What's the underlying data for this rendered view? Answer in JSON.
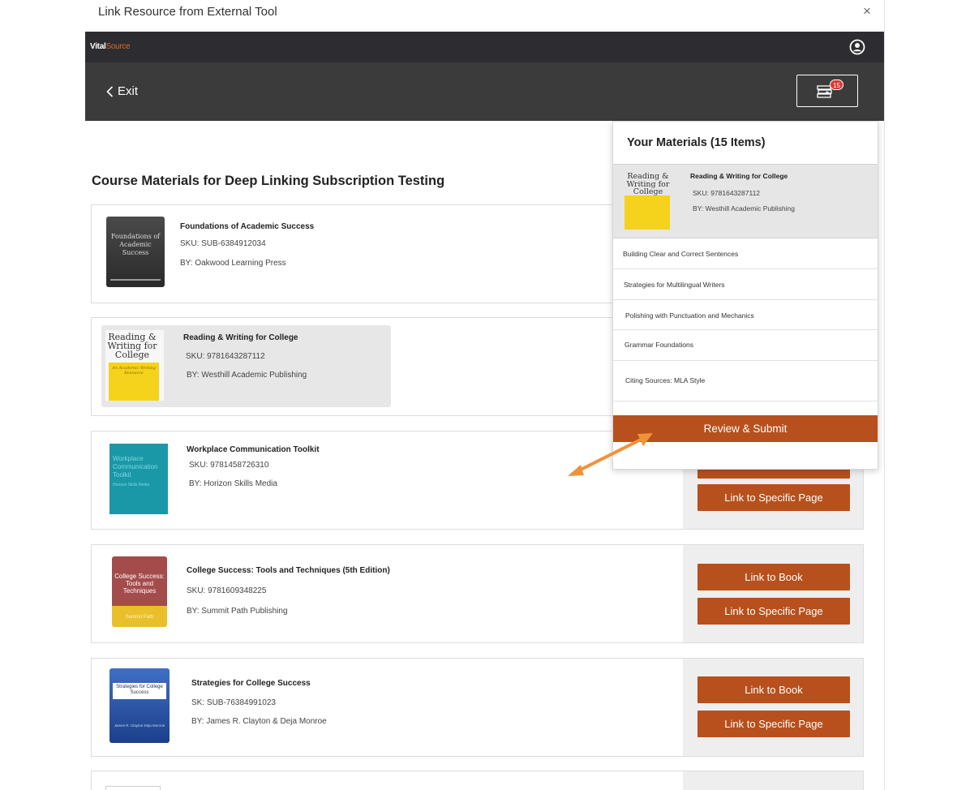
{
  "modal": {
    "title": "Link Resource from External Tool",
    "close": "×"
  },
  "topbar": {
    "brand_a": "Vital",
    "brand_b": "Source"
  },
  "subbar": {
    "exit_label": "Exit",
    "cart_count": "15"
  },
  "page": {
    "heading": "Course Materials for Deep Linking Subscription Testing"
  },
  "books": [
    {
      "cover_text": "Foundations of Academic Success",
      "title": "Foundations of Academic Success",
      "sku": "SKU: SUB-6384912034",
      "by": "BY: Oakwood Learning Press"
    },
    {
      "cover_text": "Reading & Writing for College",
      "cover_sub": "An Academic Writing Resource",
      "title": "Reading & Writing for College",
      "sku": "SKU: 9781643287112",
      "by": "BY: Westhill Academic Publishing"
    },
    {
      "cover_text": "Workplace Communication Toolkit",
      "cover_sub": "Horizon Skills Media",
      "title": "Workplace Communication Toolkit",
      "sku": "SKU: 9781458726310",
      "by": "BY: Horizon Skills Media"
    },
    {
      "cover_text": "College Success: Tools and Techniques",
      "cover_sub": "Summit Path",
      "title": "College Success: Tools and Techniques (5th Edition)",
      "sku": "SKU: 9781609348225",
      "by": "BY: Summit Path Publishing"
    },
    {
      "cover_text": "Strategies for College Success",
      "cover_sub": "James R. Clayton Deja Monroe",
      "title": "Strategies for College Success",
      "sku": "SK: SUB-76384991023",
      "by": "BY: James R. Clayton & Deja Monroe"
    }
  ],
  "buttons": {
    "link_book": "Link to Book",
    "link_page": "Link to Specific Page"
  },
  "panel": {
    "title": "Your Materials (15 Items)",
    "selected": {
      "cover_text": "Reading & Writing for College",
      "title": "Reading & Writing for College",
      "sku": "SKU: 9781643287112",
      "by": "BY: Westhill Academic Publishing"
    },
    "items": [
      "Building Clear and Correct Sentences",
      "Strategies for Multilingual Writers",
      "Polishing with Punctuation and Mechanics",
      "Grammar Foundations",
      "Citing Sources: MLA Style"
    ],
    "submit_label": "Review & Submit"
  },
  "colors": {
    "accent": "#b7501c",
    "topbar": "#2c2c31",
    "subbar": "#3b3b3b",
    "arrow": "#f0923a"
  }
}
